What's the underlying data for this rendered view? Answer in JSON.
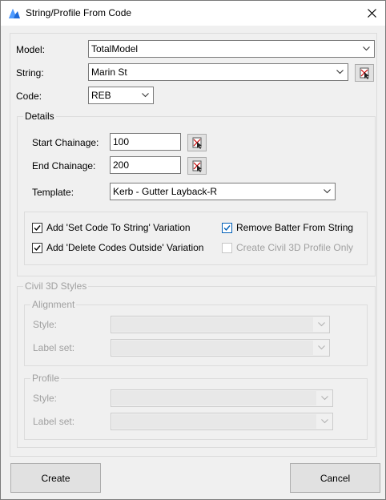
{
  "window": {
    "title": "String/Profile From Code"
  },
  "fields": {
    "model_label": "Model:",
    "model_value": "TotalModel",
    "string_label": "String:",
    "string_value": "Marin St",
    "code_label": "Code:",
    "code_value": "REB"
  },
  "details": {
    "title": "Details",
    "start_chainage_label": "Start Chainage:",
    "start_chainage_value": "100",
    "end_chainage_label": "End Chainage:",
    "end_chainage_value": "200",
    "template_label": "Template:",
    "template_value": "Kerb - Gutter Layback-R",
    "options": {
      "set_code": {
        "label": "Add 'Set Code To String' Variation",
        "checked": true
      },
      "delete_codes": {
        "label": "Add 'Delete Codes Outside' Variation",
        "checked": true
      },
      "remove_batter": {
        "label": "Remove Batter From String",
        "checked": true
      },
      "civil3d_profile_only": {
        "label": "Create Civil 3D Profile Only",
        "checked": false,
        "enabled": false
      }
    }
  },
  "civil3d_styles": {
    "title": "Civil 3D Styles",
    "alignment": {
      "title": "Alignment",
      "style_label": "Style:",
      "label_set_label": "Label set:"
    },
    "profile": {
      "title": "Profile",
      "style_label": "Style:",
      "label_set_label": "Label set:"
    }
  },
  "buttons": {
    "create": "Create",
    "cancel": "Cancel"
  },
  "colors": {
    "accent": "#005fb8",
    "disabled_text": "#a0a0a0",
    "panel": "#f0f0f0"
  },
  "icons": [
    "app-icon",
    "close-icon",
    "chevron-down-icon",
    "pick-from-drawing-icon",
    "checkmark-icon"
  ]
}
